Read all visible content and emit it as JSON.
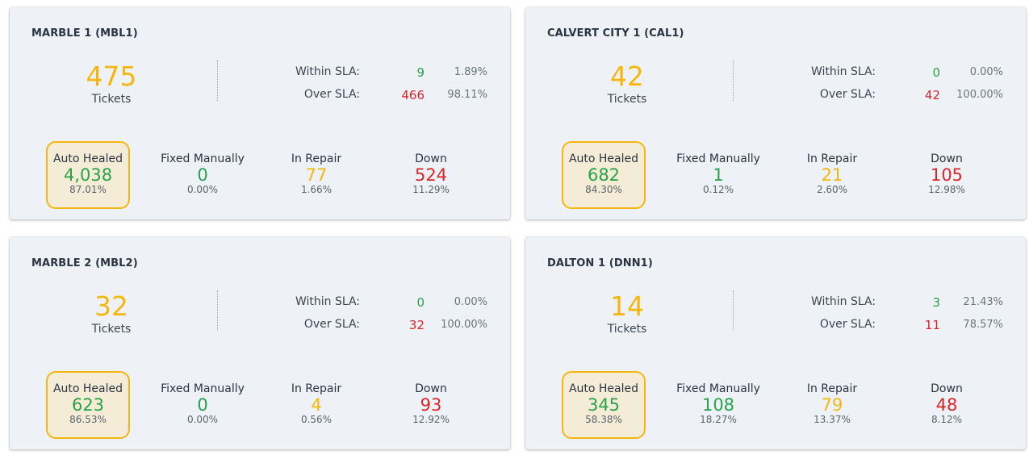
{
  "colors": {
    "accent_yellow": "#f5b70f",
    "green": "#2aa24c",
    "red": "#d8262c",
    "card_bg": "#eef2f6",
    "highlight_bg": "#f4ecd6"
  },
  "cards": [
    {
      "title": "MARBLE 1 (MBL1)",
      "tickets": "475",
      "tickets_label": "Tickets",
      "within_sla": {
        "label": "Within SLA:",
        "count": "9",
        "pct": "1.89%"
      },
      "over_sla": {
        "label": "Over SLA:",
        "count": "466",
        "pct": "98.11%"
      },
      "stats": [
        {
          "label": "Auto Healed",
          "value": "4,038",
          "pct": "87.01%"
        },
        {
          "label": "Fixed Manually",
          "value": "0",
          "pct": "0.00%"
        },
        {
          "label": "In Repair",
          "value": "77",
          "pct": "1.66%"
        },
        {
          "label": "Down",
          "value": "524",
          "pct": "11.29%"
        }
      ]
    },
    {
      "title": "CALVERT CITY 1 (CAL1)",
      "tickets": "42",
      "tickets_label": "Tickets",
      "within_sla": {
        "label": "Within SLA:",
        "count": "0",
        "pct": "0.00%"
      },
      "over_sla": {
        "label": "Over SLA:",
        "count": "42",
        "pct": "100.00%"
      },
      "stats": [
        {
          "label": "Auto Healed",
          "value": "682",
          "pct": "84.30%"
        },
        {
          "label": "Fixed Manually",
          "value": "1",
          "pct": "0.12%"
        },
        {
          "label": "In Repair",
          "value": "21",
          "pct": "2.60%"
        },
        {
          "label": "Down",
          "value": "105",
          "pct": "12.98%"
        }
      ]
    },
    {
      "title": "MARBLE 2 (MBL2)",
      "tickets": "32",
      "tickets_label": "Tickets",
      "within_sla": {
        "label": "Within SLA:",
        "count": "0",
        "pct": "0.00%"
      },
      "over_sla": {
        "label": "Over SLA:",
        "count": "32",
        "pct": "100.00%"
      },
      "stats": [
        {
          "label": "Auto Healed",
          "value": "623",
          "pct": "86.53%"
        },
        {
          "label": "Fixed Manually",
          "value": "0",
          "pct": "0.00%"
        },
        {
          "label": "In Repair",
          "value": "4",
          "pct": "0.56%"
        },
        {
          "label": "Down",
          "value": "93",
          "pct": "12.92%"
        }
      ]
    },
    {
      "title": "DALTON 1 (DNN1)",
      "tickets": "14",
      "tickets_label": "Tickets",
      "within_sla": {
        "label": "Within SLA:",
        "count": "3",
        "pct": "21.43%"
      },
      "over_sla": {
        "label": "Over SLA:",
        "count": "11",
        "pct": "78.57%"
      },
      "stats": [
        {
          "label": "Auto Healed",
          "value": "345",
          "pct": "58.38%"
        },
        {
          "label": "Fixed Manually",
          "value": "108",
          "pct": "18.27%"
        },
        {
          "label": "In Repair",
          "value": "79",
          "pct": "13.37%"
        },
        {
          "label": "Down",
          "value": "48",
          "pct": "8.12%"
        }
      ]
    }
  ]
}
